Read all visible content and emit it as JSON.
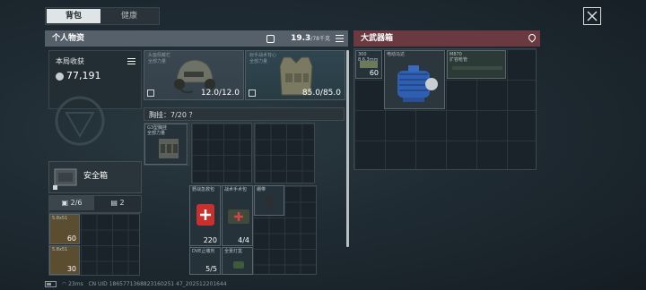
{
  "tabs": [
    {
      "label": "背包",
      "active": true
    },
    {
      "label": "健康",
      "active": false
    }
  ],
  "personal": {
    "title": "个人物资",
    "weight": "19.3",
    "weight_cap": "/78千克"
  },
  "raid_income": {
    "label": "本局收获",
    "value": "77,191"
  },
  "equipment": {
    "helmet": {
      "slot": "头盔佩戴栏\n全部力量",
      "durability": "12.0/12.0"
    },
    "armor": {
      "slot": "射手战术背心\n全部力量",
      "durability": "85.0/85.0"
    }
  },
  "rig": {
    "label": "胸挂：7/20 ？",
    "item_name": "G3型胸挂\n全部力量"
  },
  "safe_box": {
    "label": "安全箱"
  },
  "counters": {
    "left": "2/6",
    "right": "2"
  },
  "left_items": [
    {
      "name": "5.8x51",
      "count": "60"
    },
    {
      "name": "5.8x51",
      "count": "30"
    }
  ],
  "pocket_items": [
    {
      "name": "野战急救包",
      "count": "220"
    },
    {
      "name": "战术手术包",
      "count": "4/4"
    },
    {
      "name": "绷带",
      "count": ""
    },
    {
      "name": "DVE止痛剂",
      "count": "5/5"
    },
    {
      "name": "全景灯盒",
      "count": ""
    }
  ],
  "weapon_box": {
    "title": "大武器箱",
    "items": [
      {
        "name": "300\n8.6.3mm",
        "count": "60"
      },
      {
        "name": "电动马达",
        "count": ""
      },
      {
        "name": "M870\n扩容枪管",
        "count": ""
      }
    ]
  },
  "status_bar": {
    "ping": "23ms",
    "uid": "CN UID 1865771368823160251 47_202512201644"
  },
  "colors": {
    "left_header": "#56606a",
    "right_header": "#6b3a40",
    "medkit": "#c8302d",
    "motor": "#2f5fb3"
  }
}
